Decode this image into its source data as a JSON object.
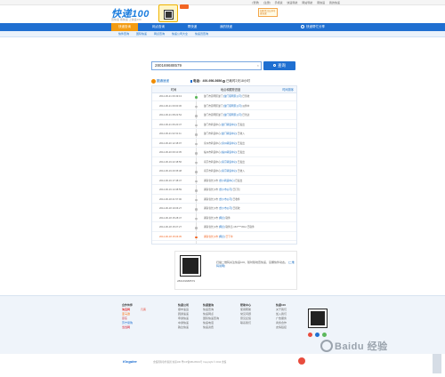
{
  "topbar": {
    "links": [
      "[登录]",
      "[注册]",
      "手机版",
      "快递导航",
      "网站导航",
      "寄快递",
      "我的快递"
    ]
  },
  "header": {
    "logo": "快递100",
    "slogan": "查快递  寄快递  上快递100",
    "wechat_box": "扫码关注公众号查快递"
  },
  "nav": {
    "items": [
      {
        "label": "快递查询",
        "active": true
      },
      {
        "label": "网点查询",
        "active": false
      },
      {
        "label": "寄快递",
        "active": false
      },
      {
        "label": "我的快递",
        "active": false
      }
    ],
    "right": "快递帮忙分享"
  },
  "subnav": {
    "items": [
      "快件查询",
      "国际快递",
      "网点查询",
      "快递公司大全",
      "快递员查询"
    ]
  },
  "search": {
    "value": "280169688579",
    "clear_icon": "close-icon",
    "button_label": "查询"
  },
  "result": {
    "company": "圆通速递",
    "phone": "电话：400-956-5656",
    "elapsed": "已耗时2天18小时"
  },
  "table": {
    "headers": {
      "time": "时间",
      "location": "地点和跟踪进度",
      "sort": "时间排序"
    },
    "rows": [
      {
        "time": "2014-06-21 09:49:13",
        "text": "厦门市思明区厦门 ",
        "link": "[厦门思明区公司]",
        "tail": " 已签收"
      },
      {
        "time": "2014-06-21 09:00:36",
        "text": "厦门市思明区厦门 ",
        "link": "[厦门思明区公司]",
        "tail": " 派件中"
      },
      {
        "time": "2014-06-21 08:22:54",
        "text": "厦门市思明区厦门 ",
        "link": "[厦门思明区公司]",
        "tail": " 已到达"
      },
      {
        "time": "2014-06-21 06:20:47",
        "text": "厦门市转运中心 ",
        "link": "[厦门转运中心]",
        "tail": " 已发出"
      },
      {
        "time": "2014-06-21 02:31:11",
        "text": "厦门市转运中心 ",
        "link": "[厦门转运中心]",
        "tail": " 已收入"
      },
      {
        "time": "2014-06-20 12:48:07",
        "text": "泉州市转运中心 ",
        "link": "[泉州转运中心]",
        "tail": " 已发出"
      },
      {
        "time": "2014-06-20 09:10:35",
        "text": "福州市转运中心 ",
        "link": "[福州转运中心]",
        "tail": " 已发出"
      },
      {
        "time": "2014-06-19 22:48:56",
        "text": "南京市转运中心 ",
        "link": "[南京转运中心]",
        "tail": " 已发出"
      },
      {
        "time": "2014-06-19 20:35:48",
        "text": "南京市转运中心 ",
        "link": "[南京转运中心]",
        "tail": " 已收入"
      },
      {
        "time": "2014-06-19 17:48:47",
        "text": "湖南省长沙市 ",
        "link": "[长沙转运中心]",
        "tail": " 已发出"
      },
      {
        "time": "2014-06-19 14:38:59",
        "text": "湖南省长沙市 ",
        "link": "[长沙市公司]",
        "tail": " 已打包"
      },
      {
        "time": "2014-06-18 21:57:00",
        "text": "湖南省长沙市 ",
        "link": "[长沙市公司]",
        "tail": " 已收件"
      },
      {
        "time": "2014-06-18 19:06:27",
        "text": "湖南省长沙市 ",
        "link": "[长沙市公司]",
        "tail": " 已揽收"
      },
      {
        "time": "2014-06-18 15:28:47",
        "text": "湖南省长沙市 ",
        "link": "[网点]",
        "tail": " 取件"
      },
      {
        "time": "2014-06-18 15:07:27",
        "text": "湖南省长沙市 ",
        "link": "[网点]",
        "tail": " 取件员 153****4512 已取件"
      },
      {
        "time": "2014-06-18 15:06:35",
        "text": "湖南省长沙市 ",
        "link": "[网点]",
        "tail": " 已下单"
      }
    ]
  },
  "qr": {
    "number": "280169688579",
    "text": "扫描二维码关注快递100，随时随地查快递，掌握快件动态。",
    "link": "[二维码说明]"
  },
  "footer": {
    "col1": {
      "title": "合作伙伴",
      "items": [
        "淘宝网",
        "亚马逊",
        "京东",
        "苏宁易购",
        "当当网",
        "凡客"
      ]
    },
    "col2": {
      "title": "快递公司",
      "items": [
        "顺丰速运",
        "圆通速递",
        "申通快递",
        "中通快递",
        "韵达快递",
        "EMS"
      ]
    },
    "col3": {
      "title": "快递查询",
      "items": [
        "快递查询",
        "快递网点",
        "国际快递查询",
        "快递电话",
        "快递资费"
      ]
    },
    "col4": {
      "title": "帮助中心",
      "items": [
        "使用帮助",
        "常见问题",
        "意见反馈",
        "联系我们"
      ]
    },
    "col5": {
      "title": "快递100",
      "items": [
        "关于我们",
        "加入我们",
        "广告服务",
        "商务合作",
        "友情链接"
      ]
    }
  },
  "copyright": {
    "logo": "Kingdee",
    "text": "金蝶国际软件集团 快递100 粤ICP备08126519号 Copyright © 2014 金蝶"
  },
  "watermark": "Baidu 经验",
  "colors": {
    "primary": "#1f6fd1",
    "accent": "#f39c12",
    "latest": "#f26522"
  }
}
